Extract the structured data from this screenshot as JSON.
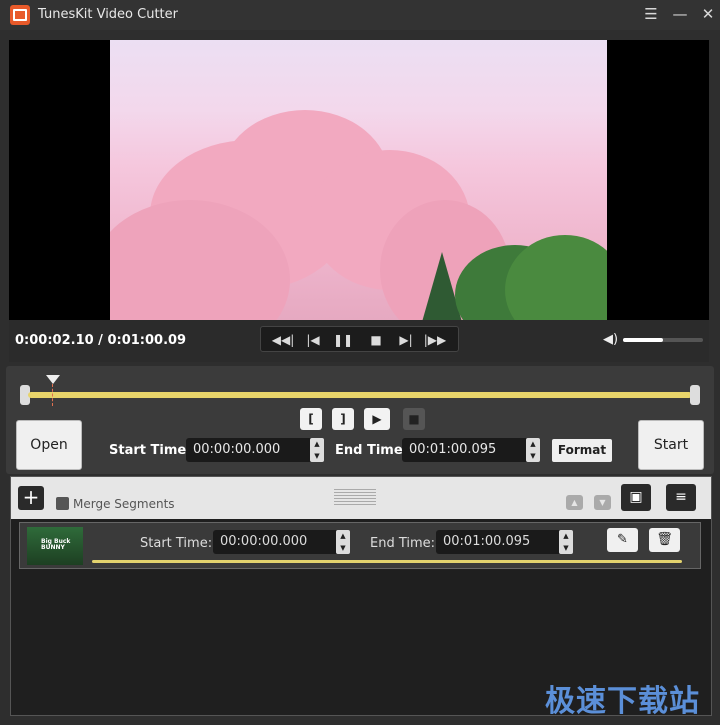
{
  "window": {
    "title": "TunesKit Video Cutter",
    "menu_icon": "☰",
    "minimize_icon": "—",
    "close_icon": "✕"
  },
  "player": {
    "time_readout": "0:00:02.10 / 0:01:00.09",
    "volume_fraction": 0.5,
    "transport": {
      "prev_segment_icon": "◀◀|",
      "prev_frame_icon": "|◀",
      "pause_icon": "❚❚",
      "stop_icon": "■",
      "next_frame_icon": "▶|",
      "next_segment_icon": "|▶▶"
    },
    "volume_icon": "◀)"
  },
  "cutter": {
    "mark_in_label": "[",
    "mark_out_label": "]",
    "preview_icon": "▶",
    "stop_icon": "■",
    "open_label": "Open",
    "start_label": "Start",
    "start_time_label": "Start Time:",
    "start_time_value": "00:00:00.000",
    "end_time_label": "End Time:",
    "end_time_value": "00:01:00.095",
    "format_label": "Format",
    "spin_up": "▲",
    "spin_down": "▼"
  },
  "segments": {
    "add_label": "+",
    "merge_label": "Merge Segments",
    "up_icon": "▲",
    "down_icon": "▼",
    "folder_icon": "▣",
    "sort_icon": "≡",
    "rows": [
      {
        "thumbnail_text": "Big Buck BUNNY",
        "start_time_label": "Start Time:",
        "start_time_value": "00:00:00.000",
        "end_time_label": "End Time:",
        "end_time_value": "00:01:00.095",
        "edit_icon": "✎",
        "delete_icon": "🗑"
      }
    ]
  },
  "watermark": "极速下载站"
}
